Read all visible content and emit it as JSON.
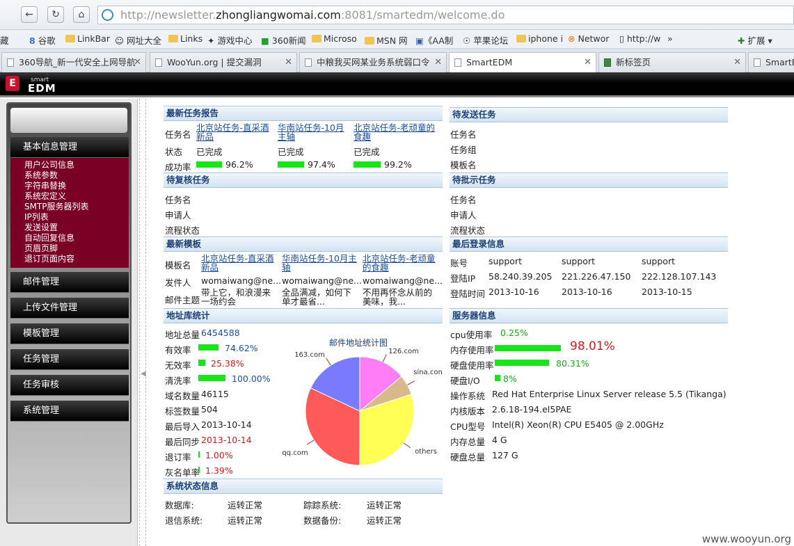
{
  "browser": {
    "url_prefix": "http://newsletter.",
    "url_host": "zhongliangwomai.com",
    "url_rest": ":8081/smartedm/welcome.do",
    "bookmarks": [
      "藏",
      "谷歌",
      "LinkBar",
      "网址大全",
      "Links",
      "游戏中心",
      "360新闻",
      "Microso",
      "MSN 网",
      "《AA制",
      "苹果论坛",
      "iphone i",
      "Networ",
      "http://w",
      "»",
      "扩展"
    ],
    "tabs": [
      {
        "label": "360导航_新一代安全上网导航",
        "active": false
      },
      {
        "label": "WooYun.org | 提交漏洞",
        "active": false
      },
      {
        "label": "中粮我买网某业务系统弱口令",
        "active": false
      },
      {
        "label": "SmartEDM",
        "active": true
      },
      {
        "label": "新标签页",
        "active": false
      },
      {
        "label": "SmartE",
        "active": false
      }
    ]
  },
  "app": {
    "logo_small": "smart",
    "logo_big": "EDM",
    "logo_letter": "E"
  },
  "sidebar": {
    "menu": [
      "基本信息管理",
      "邮件管理",
      "上传文件管理",
      "模板管理",
      "任务管理",
      "任务审核",
      "系统管理"
    ],
    "submenu": [
      "用户公司信息",
      "系统参数",
      "字符串替换",
      "系统宏定义",
      "SMTP服务器列表",
      "IP列表",
      "发送设置",
      "自动回复信息",
      "页眉页脚",
      "退订页面内容"
    ]
  },
  "latest_tasks": {
    "title": "最新任务报告",
    "labels": [
      "任务名",
      "状态",
      "成功率"
    ],
    "items": [
      {
        "name": "北京站任务-直采酒新品",
        "status": "已完成",
        "rate": "96.2%",
        "rate_value": 0.962
      },
      {
        "name": "华南站任务-10月主轴",
        "status": "已完成",
        "rate": "97.4%",
        "rate_value": 0.974
      },
      {
        "name": "北京站任务-老顽童的食趣",
        "status": "已完成",
        "rate": "99.2%",
        "rate_value": 0.992
      }
    ]
  },
  "pending_send": {
    "title": "待发送任务",
    "labels": [
      "任务名",
      "任务组",
      "模板名"
    ]
  },
  "pending_review": {
    "title": "待复核任务",
    "labels": [
      "任务名",
      "申请人",
      "流程状态"
    ]
  },
  "pending_approve": {
    "title": "待批示任务",
    "labels": [
      "任务名",
      "申请人",
      "流程状态"
    ]
  },
  "latest_templates": {
    "title": "最新模板",
    "labels": [
      "模板名",
      "发件人",
      "邮件主题"
    ],
    "items": [
      {
        "name": "北京站任务-直采酒新品",
        "sender": "womaiwang@ne...",
        "subject": "带上它，和浪漫来一场约会"
      },
      {
        "name": "华南站任务-10月主轴",
        "sender": "womaiwang@ne...",
        "subject": "全品满减，如何下单才最省..."
      },
      {
        "name": "北京站任务-老顽童的食趣",
        "sender": "womaiwang@ne...",
        "subject": "不用再怀念从前的美味，我..."
      }
    ]
  },
  "last_login": {
    "title": "最后登录信息",
    "labels": [
      "账号",
      "登陆IP",
      "登陆时间"
    ],
    "rows": [
      {
        "account": "support",
        "ip": "58.240.39.205",
        "time": "2013-10-16"
      },
      {
        "account": "support",
        "ip": "221.226.47.150",
        "time": "2013-10-16"
      },
      {
        "account": "support",
        "ip": "222.128.107.143",
        "time": "2013-10-15"
      }
    ]
  },
  "address_stats": {
    "title": "地址库统计",
    "total_label": "地址总量",
    "total": "6454588",
    "valid_label": "有效率",
    "valid": "74.62%",
    "valid_value": 0.7462,
    "invalid_label": "无效率",
    "invalid": "25.38%",
    "invalid_value": 0.2538,
    "clean_label": "清洗率",
    "clean": "100.00%",
    "clean_value": 1.0,
    "domains_label": "域名数量",
    "domains": "46115",
    "tags_label": "标签数量",
    "tags": "504",
    "last_import_label": "最后导入",
    "last_import": "2013-10-14",
    "last_sync_label": "最后同步",
    "last_sync": "2013-10-14",
    "unsub_label": "退订率",
    "unsub": "1.00%",
    "unsub_value": 0.01,
    "gray_label": "灰名单率",
    "gray": "1.39%",
    "gray_value": 0.0139
  },
  "chart_data": {
    "type": "pie",
    "title": "邮件地址统计图",
    "slices": [
      {
        "label": "126.com",
        "value": 14,
        "color": "#ff7ef5"
      },
      {
        "label": "sina.con",
        "value": 6,
        "color": "#d8b98a"
      },
      {
        "label": "others",
        "value": 30,
        "color": "#ffff55"
      },
      {
        "label": "qq.com",
        "value": 32,
        "color": "#ff5a5a"
      },
      {
        "label": "163.com",
        "value": 18,
        "color": "#7a7aff"
      }
    ]
  },
  "server_info": {
    "title": "服务器信息",
    "cpu_label": "cpu使用率",
    "cpu": "0.25%",
    "mem_label": "内存使用率",
    "mem": "98.01%",
    "mem_value": 0.9801,
    "disk_label": "硬盘使用率",
    "disk": "80.31%",
    "disk_value": 0.8031,
    "io_label": "硬盘I/O",
    "io": "8%",
    "io_value": 0.08,
    "os_label": "操作系统",
    "os": "Red Hat Enterprise Linux Server release 5.5 (Tikanga)",
    "kernel_label": "内核版本",
    "kernel": "2.6.18-194.el5PAE",
    "cpu_model_label": "CPU型号",
    "cpu_model": "Intel(R) Xeon(R) CPU E5405 @ 2.00GHz",
    "mem_total_label": "内存总量",
    "mem_total": "4 G",
    "disk_total_label": "硬盘总量",
    "disk_total": "127 G"
  },
  "system_status": {
    "title": "系统状态信息",
    "items": [
      {
        "label": "数据库:",
        "value": "运转正常"
      },
      {
        "label": "踪踪系统:",
        "value": "运转正常"
      },
      {
        "label": "退信系统:",
        "value": "运转正常"
      },
      {
        "label": "数据备份:",
        "value": "运转正常"
      }
    ]
  },
  "watermark": "www.wooyun.org"
}
